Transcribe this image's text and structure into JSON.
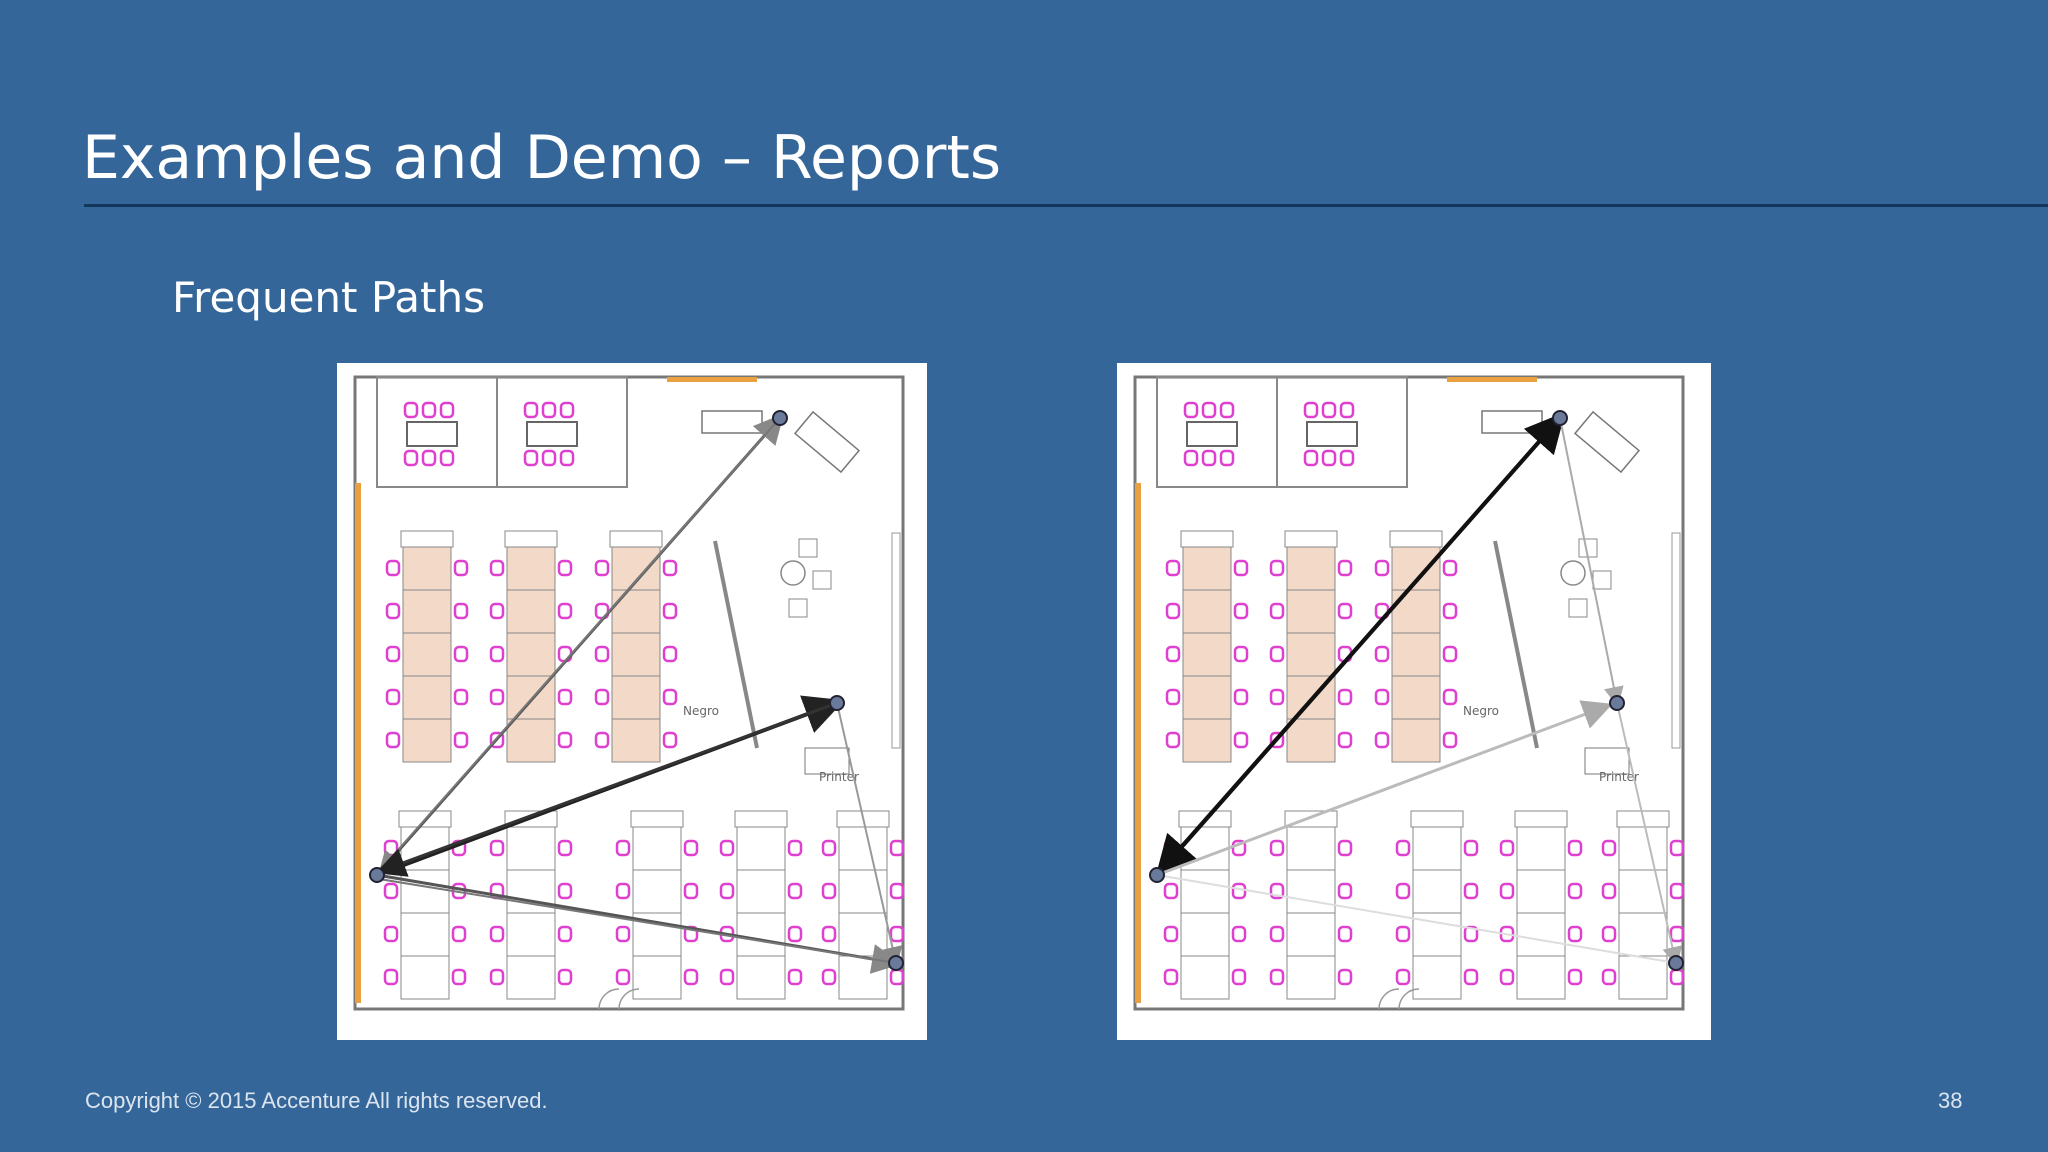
{
  "slide": {
    "title": "Examples and Demo – Reports",
    "subtitle": "Frequent Paths",
    "copyright": "Copyright © 2015 Accenture  All rights reserved.",
    "page_number": "38"
  },
  "floorplans": [
    {
      "room_label": "Negro",
      "printer_label": "Printer"
    },
    {
      "room_label": "Negro",
      "printer_label": "Printer"
    }
  ],
  "colors": {
    "background": "#346699",
    "title_rule": "#13365d",
    "chair": "#e040d0",
    "desk_fill": "#f2d9c8",
    "wall_accent": "#e8a040",
    "path_dark": "#222222",
    "path_light": "#999999"
  }
}
